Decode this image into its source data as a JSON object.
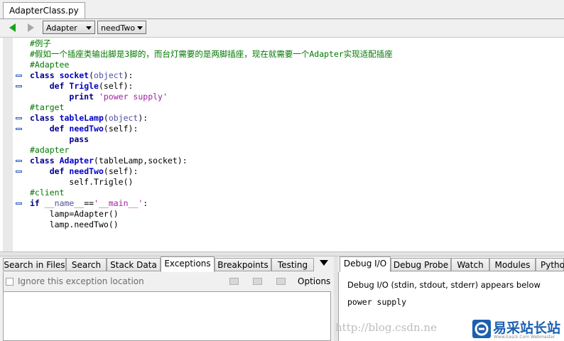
{
  "file_tab": {
    "label": "AdapterClass.py"
  },
  "toolbar": {
    "back_icon": "arrow-left-icon",
    "forward_icon": "arrow-right-icon",
    "class_combo": "Adapter",
    "method_combo": "needTwo"
  },
  "code": {
    "lines": [
      "#例子",
      "#假如一个插座类输出脚是3脚的，而台灯需要的是两脚插座，现在就需要一个Adapter实现适配插座",
      "#Adaptee",
      "class socket(object):",
      "    def Trigle(self):",
      "        print 'power supply'",
      "#target",
      "class tableLamp(object):",
      "    def needTwo(self):",
      "        pass",
      "#adapter",
      "class Adapter(tableLamp,socket):",
      "    def needTwo(self):",
      "        self.Trigle()",
      "#client",
      "if __name__=='__main__':",
      "    lamp=Adapter()",
      "    lamp.needTwo()"
    ],
    "fold_marker_lines": [
      3,
      4,
      7,
      8,
      11,
      12,
      15
    ]
  },
  "left_tabs": {
    "items": [
      "Search in Files",
      "Search",
      "Stack Data",
      "Exceptions",
      "Breakpoints",
      "Testing"
    ],
    "active": "Exceptions",
    "menu_icon": "triangle-down-icon"
  },
  "exceptions": {
    "ignore_label": "Ignore this exception location",
    "ignore_checked": false,
    "options_label": "Options"
  },
  "right_tabs": {
    "items": [
      "Debug I/O",
      "Debug Probe",
      "Watch",
      "Modules",
      "Pytho"
    ],
    "active": "Debug I/O"
  },
  "debug_io": {
    "description": "Debug I/O (stdin, stdout, stderr) appears below",
    "output": "power supply"
  },
  "watermark": {
    "url": "http://blog.csdn.ne",
    "brand": "易采站长站",
    "brand_sub": "Www.Easck.Com  Webmaster"
  },
  "colors": {
    "comment": "#007800",
    "keyword": "#00008b",
    "function": "#0000c8",
    "string": "#a020a0",
    "nav_arrow": "#1aa31a"
  }
}
